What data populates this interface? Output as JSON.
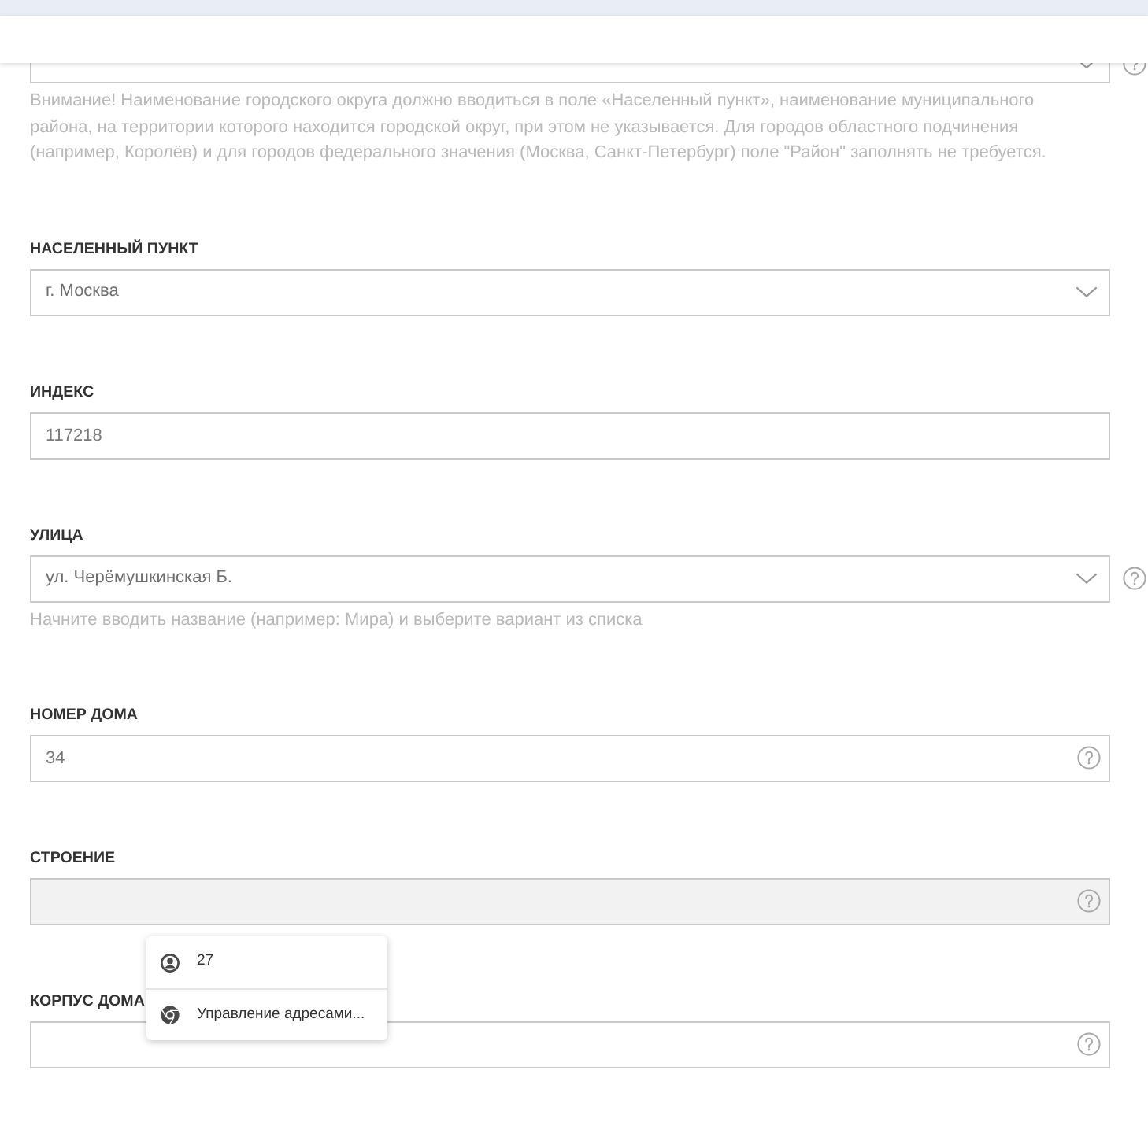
{
  "fields": [
    {
      "kind": "select",
      "focused": false,
      "help_inside": false,
      "help_outside": true,
      "hint": "Внимание! Наименование городского округа должно вводиться в поле «Населенный пункт», наименование муниципального района, на территории которого находится городской округ, при этом не указывается. Для городов областного подчинения (например, Королёв) и для городов федерального значения (Москва, Санкт-Петербург) поле \"Район\" заполнять не требуется."
    },
    {
      "label": "НАСЕЛЕННЫЙ ПУНКТ",
      "kind": "select",
      "focused": false,
      "help_inside": false,
      "help_outside": false,
      "value": "г. Москва"
    },
    {
      "label": "ИНДЕКС",
      "kind": "text",
      "focused": false,
      "help_inside": false,
      "help_outside": false,
      "value": "117218"
    },
    {
      "label": "УЛИЦА",
      "kind": "select",
      "focused": false,
      "help_inside": false,
      "help_outside": true,
      "value": "ул. Черёмушкинская Б.",
      "hint": "Начните вводить название (например: Мира) и выберите вариант из списка"
    },
    {
      "label": "НОМЕР ДОМА",
      "kind": "text",
      "focused": false,
      "help_inside": true,
      "help_outside": false,
      "value": "34"
    },
    {
      "label": "СТРОЕНИЕ",
      "kind": "text",
      "focused": true,
      "help_inside": true,
      "help_outside": false
    },
    {
      "label": "КОРПУС ДОМА",
      "kind": "text",
      "focused": false,
      "help_inside": true,
      "help_outside": false
    }
  ],
  "autofill_popup": {
    "items": [
      {
        "kind": "profile",
        "text": "27"
      },
      {
        "kind": "manage",
        "text": "Управление адресами..."
      }
    ]
  }
}
